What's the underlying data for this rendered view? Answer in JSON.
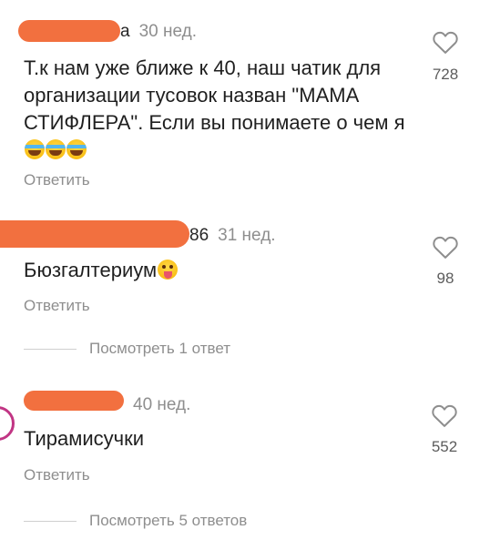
{
  "comments": [
    {
      "username_visible": "a",
      "time": "30 нед.",
      "text": "Т.к нам уже ближе к 40, наш чатик для организации тусовок назван \"МАМА СТИФЛЕРА\". Если вы понимаете о чем я",
      "reply_label": "Ответить",
      "likes": "728"
    },
    {
      "username_visible": "86",
      "time": "31 нед.",
      "text": "Бюзгалтериум",
      "reply_label": "Ответить",
      "likes": "98",
      "view_replies": "Посмотреть 1 ответ"
    },
    {
      "username_visible": "",
      "time": "40 нед.",
      "text": "Тирамисучки",
      "reply_label": "Ответить",
      "likes": "552",
      "view_replies": "Посмотреть 5 ответов"
    }
  ],
  "icons": {
    "like": "heart-outline-icon",
    "emoji_1": "face-with-tears-of-joy",
    "emoji_2": "winking-face-with-tongue"
  },
  "colors": {
    "redaction": "#f2703f",
    "secondary_text": "#8e8e8e",
    "avatar_ring": "#c13584"
  }
}
